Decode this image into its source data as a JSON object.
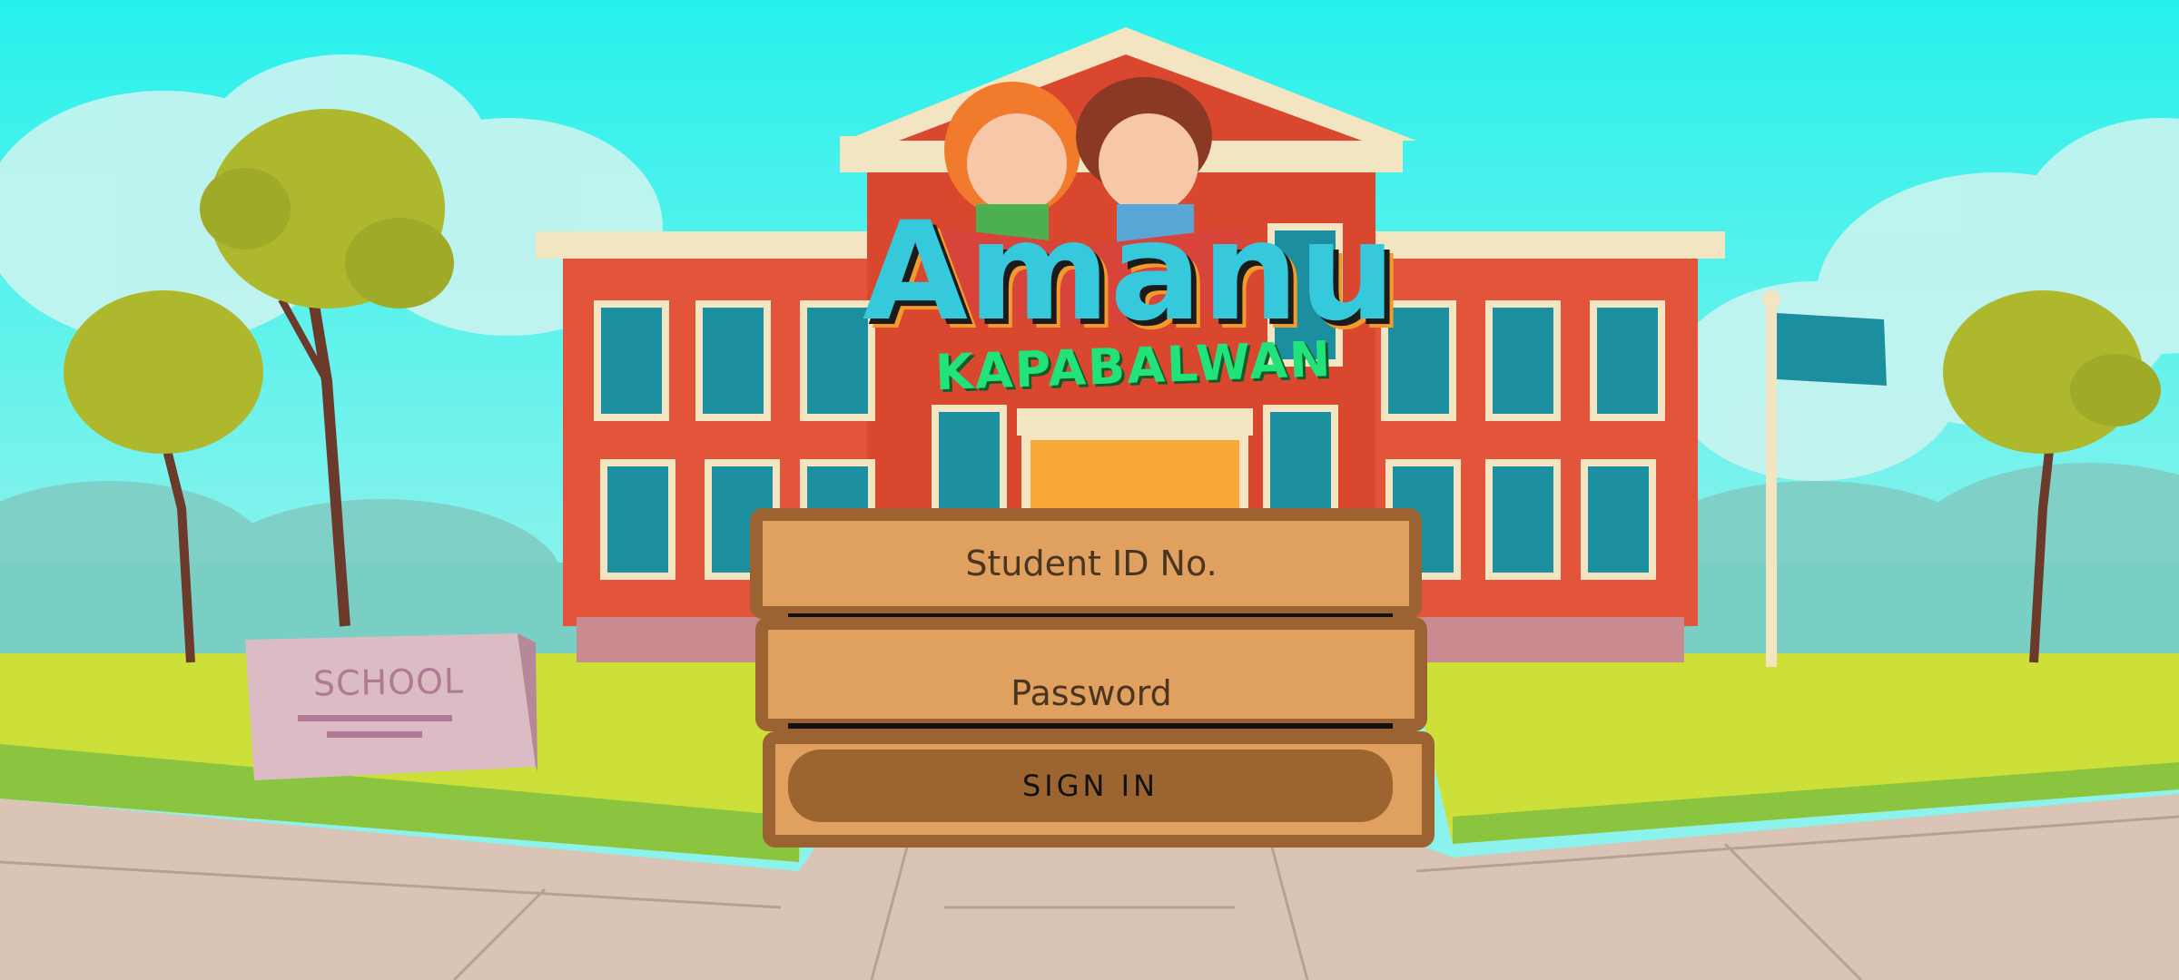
{
  "app": {
    "logo_title": "Amanu",
    "logo_subtitle": "KAPABALWAN"
  },
  "scene": {
    "stone_sign": "SCHOOL"
  },
  "login": {
    "student_id_placeholder": "Student ID No.",
    "student_id_value": "",
    "password_placeholder": "Password",
    "password_value": "",
    "signin_label": "SIGN IN"
  },
  "colors": {
    "sky": "#29f0ec",
    "grass": "#cde03a",
    "building": "#e2553a",
    "wood_light": "#e0a060",
    "wood_dark": "#9b6332"
  }
}
